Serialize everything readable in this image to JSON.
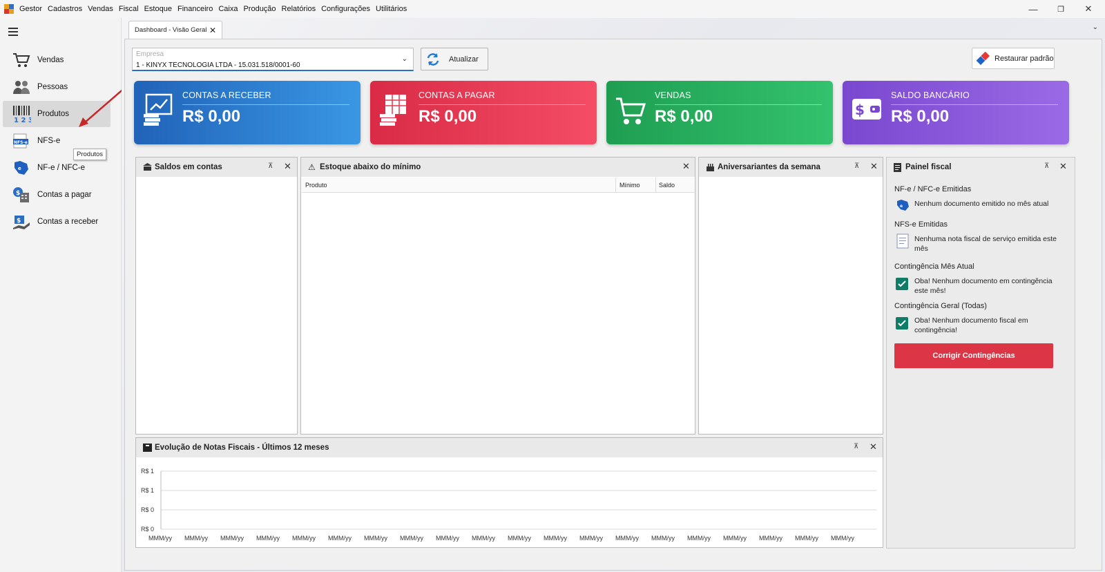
{
  "app": {
    "title": "Gestor",
    "menu": [
      "Cadastros",
      "Vendas",
      "Fiscal",
      "Estoque",
      "Financeiro",
      "Caixa",
      "Produção",
      "Relatórios",
      "Configurações",
      "Utilitários"
    ]
  },
  "window_controls": {
    "minimize": "—",
    "maximize": "❐",
    "close": "✕"
  },
  "sidebar": {
    "items": [
      {
        "label": "Vendas",
        "icon": "cart-icon"
      },
      {
        "label": "Pessoas",
        "icon": "people-icon"
      },
      {
        "label": "Produtos",
        "icon": "barcode-icon",
        "active": true
      },
      {
        "label": "NFS-e",
        "icon": "nfse-icon"
      },
      {
        "label": "NF-e / NFC-e",
        "icon": "nfe-icon"
      },
      {
        "label": "Contas a pagar",
        "icon": "payable-icon"
      },
      {
        "label": "Contas a receber",
        "icon": "receivable-icon"
      }
    ],
    "tooltip": "Produtos"
  },
  "tab": {
    "label": "Dashboard - Visão Geral",
    "close": "✕"
  },
  "empresa": {
    "placeholder": "Empresa",
    "value": "1 - KINYX TECNOLOGIA LTDA - 15.031.518/0001-60"
  },
  "buttons": {
    "atualizar": "Atualizar",
    "restaurar": "Restaurar padrão",
    "corrigir": "Corrigir Contingências"
  },
  "cards": [
    {
      "title": "CONTAS A RECEBER",
      "value": "R$ 0,00",
      "color": "#2b7fd0"
    },
    {
      "title": "CONTAS A PAGAR",
      "value": "R$ 0,00",
      "color": "#e33a4f"
    },
    {
      "title": "VENDAS",
      "value": "R$ 0,00",
      "color": "#27ad5c"
    },
    {
      "title": "SALDO BANCÁRIO",
      "value": "R$ 0,00",
      "color": "#8657d8"
    }
  ],
  "panels": {
    "saldos": {
      "title": "Saldos em contas"
    },
    "estoque": {
      "title": "Estoque abaixo do mínimo",
      "columns": [
        "Produto",
        "Mínimo",
        "Saldo"
      ]
    },
    "aniversariantes": {
      "title": "Aniversariantes da semana"
    },
    "fiscal": {
      "title": "Painel fiscal",
      "nfe_title": "NF-e / NFC-e Emitidas",
      "nfe_msg": "Nenhum documento emitido no mês atual",
      "nfse_title": "NFS-e Emitidas",
      "nfse_msg": "Nenhuma nota fiscal de serviço emitida este mês",
      "cont_atual_title": "Contingência Mês Atual",
      "cont_atual_msg": "Oba! Nenhum documento em contingência este mês!",
      "cont_geral_title": "Contingência Geral (Todas)",
      "cont_geral_msg": "Oba! Nenhum documento fiscal em contingência!"
    },
    "evolucao": {
      "title": "Evolução de Notas Fiscais - Últimos 12 meses"
    }
  },
  "chart_data": {
    "type": "line",
    "title": "Evolução de Notas Fiscais - Últimos 12 meses",
    "y_tick_labels": [
      "R$ 1",
      "R$ 1",
      "R$ 0",
      "R$ 0"
    ],
    "x_tick_labels": [
      "MMM/yy",
      "MMM/yy",
      "MMM/yy",
      "MMM/yy",
      "MMM/yy",
      "MMM/yy",
      "MMM/yy",
      "MMM/yy",
      "MMM/yy",
      "MMM/yy",
      "MMM/yy",
      "MMM/yy",
      "MMM/yy",
      "MMM/yy",
      "MMM/yy",
      "MMM/yy",
      "MMM/yy",
      "MMM/yy",
      "MMM/yy",
      "MMM/yy"
    ],
    "series": [],
    "grid": true
  }
}
